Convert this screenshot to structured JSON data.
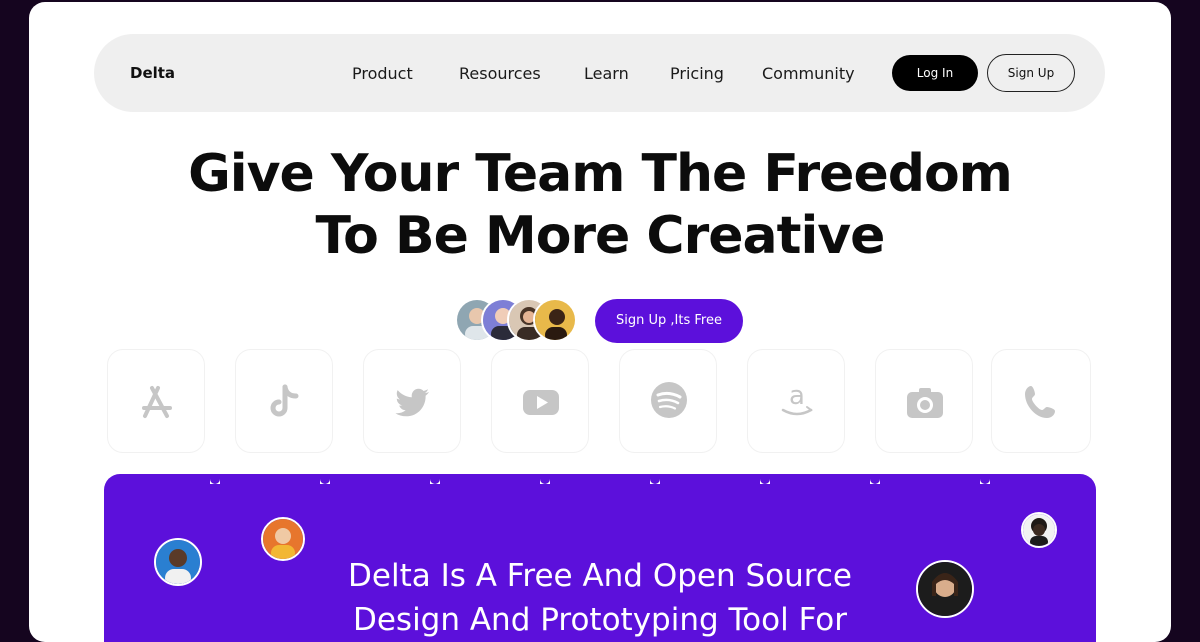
{
  "nav": {
    "brand": "Delta",
    "links": [
      "Product",
      "Resources",
      "Learn",
      "Pricing",
      "Community"
    ],
    "login_label": "Log In",
    "signup_label": "Sign Up"
  },
  "hero": {
    "title_line1": "Give Your Team The Freedom",
    "title_line2": "To Be More Creative",
    "cta_label": "Sign Up ,Its Free"
  },
  "app_icons": [
    "app-store-icon",
    "tiktok-icon",
    "twitter-icon",
    "youtube-icon",
    "spotify-icon",
    "amazon-icon",
    "camera-icon",
    "phone-icon"
  ],
  "panel": {
    "line1": "Delta Is A Free And Open Source",
    "line2": "Design And Prototyping Tool For"
  },
  "colors": {
    "accent": "#5c10db",
    "background": "#15051f",
    "nav_bg": "#efefef",
    "icon_gray": "#c6c6c6"
  }
}
